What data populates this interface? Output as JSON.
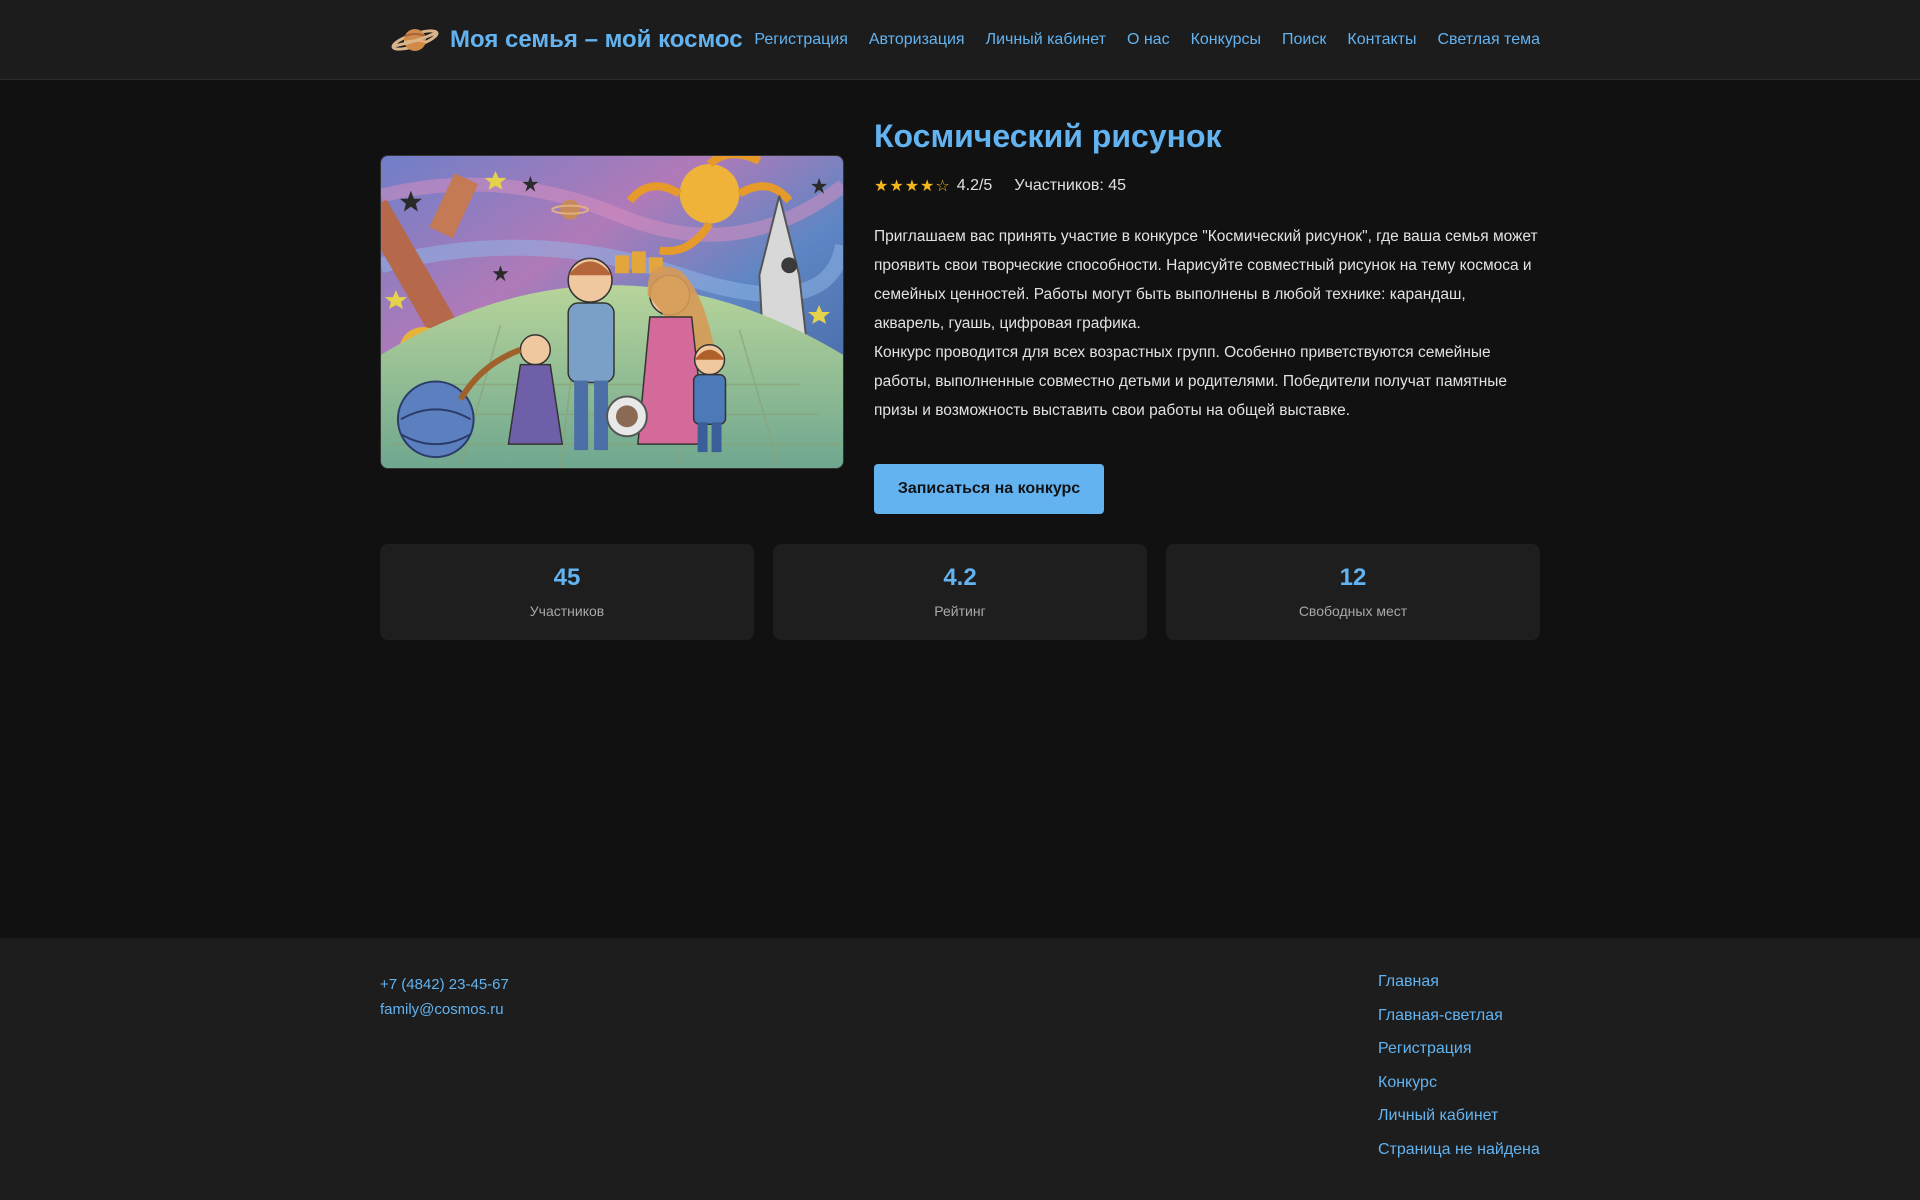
{
  "header": {
    "title": "Моя семья – мой космос",
    "logo_icon": "planet-icon",
    "nav": [
      {
        "label": "Регистрация"
      },
      {
        "label": "Авторизация"
      },
      {
        "label": "Личный кабинет"
      },
      {
        "label": "О нас"
      },
      {
        "label": "Конкурсы"
      },
      {
        "label": "Поиск"
      },
      {
        "label": "Контакты"
      },
      {
        "label": "Светлая тема"
      }
    ]
  },
  "contest": {
    "title": "Космический рисунок",
    "rating": 4.2,
    "rating_text": "4.2/5",
    "participants_text": "Участников: 45",
    "description": [
      "Приглашаем вас принять участие в конкурсе \"Космический рисунок\", где ваша семья может проявить свои творческие способности. Нарисуйте совместный рисунок на тему космоса и семейных ценностей. Работы могут быть выполнены в любой технике: карандаш, акварель, гуашь, цифровая графика.",
      "Конкурс проводится для всех возрастных групп. Особенно приветствуются семейные работы, выполненные совместно детьми и родителями. Победители получат памятные призы и возможность выставить свои работы на общей выставке."
    ],
    "join_button": "Записаться на конкурс"
  },
  "stats": [
    {
      "value": "45",
      "label": "Участников"
    },
    {
      "value": "4.2",
      "label": "Рейтинг"
    },
    {
      "value": "12",
      "label": "Свободных мест"
    }
  ],
  "footer": {
    "phone": "+7 (4842) 23-45-67",
    "email": "family@cosmos.ru",
    "links": [
      {
        "label": "Главная"
      },
      {
        "label": "Главная-светлая"
      },
      {
        "label": "Регистрация"
      },
      {
        "label": "Конкурс"
      },
      {
        "label": "Личный кабинет"
      },
      {
        "label": "Страница не найдена"
      }
    ]
  },
  "colors": {
    "accent": "#63b3f0",
    "star": "#f5b71c",
    "background": "#111111",
    "surface": "#1e1e1e"
  }
}
